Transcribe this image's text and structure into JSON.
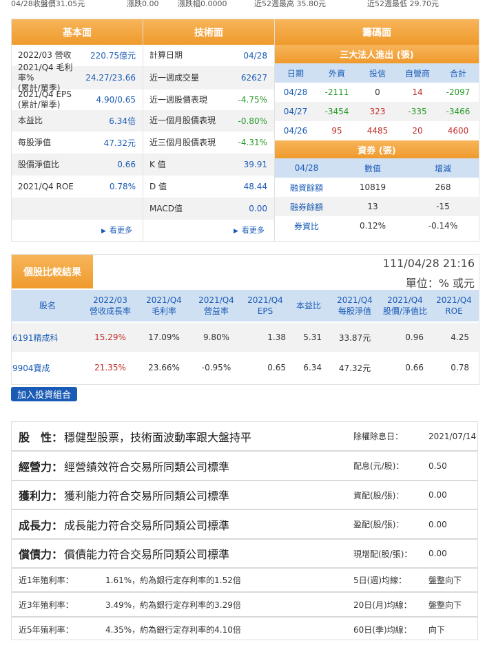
{
  "topline": {
    "close_price": "04/28收盤價31.05元",
    "change": "漲跌0.00",
    "change_pct": "漲跌幅0.0000",
    "high52": "近52週最高 35.80元",
    "low52": "近52週最低 29.70元"
  },
  "fundamental": {
    "header": "基本面",
    "rows": [
      {
        "label": "2022/03 營收",
        "value": "220.75億元"
      },
      {
        "label": "2021/Q4 毛利率%\n(累計/單季)",
        "value": "24.27/23.66"
      },
      {
        "label": "2021/Q4 EPS\n(累計/單季)",
        "value": "4.90/0.65"
      },
      {
        "label": "本益比",
        "value": "6.34倍"
      },
      {
        "label": "每股淨值",
        "value": "47.32元"
      },
      {
        "label": "股價淨值比",
        "value": "0.66"
      },
      {
        "label": "2021/Q4 ROE",
        "value": "0.78%"
      }
    ],
    "more": "看更多"
  },
  "technical": {
    "header": "技術面",
    "rows": [
      {
        "label": "計算日期",
        "value": "04/28"
      },
      {
        "label": "近一週成交量",
        "value": "62627"
      },
      {
        "label": "近一週股價表現",
        "value": "-4.75%"
      },
      {
        "label": "近一個月股價表現",
        "value": "-0.80%"
      },
      {
        "label": "近三個月股價表現",
        "value": "-4.31%"
      },
      {
        "label": "K 值",
        "value": "39.91"
      },
      {
        "label": "D 值",
        "value": "48.44"
      },
      {
        "label": "MACD值",
        "value": "0.00"
      }
    ],
    "more": "看更多"
  },
  "chips": {
    "header": "籌碼面",
    "institutional": {
      "title": "三大法人進出 (張)",
      "columns": [
        "日期",
        "外資",
        "投信",
        "自營商",
        "合計"
      ],
      "rows": [
        [
          "04/28",
          "-2111",
          "0",
          "14",
          "-2097"
        ],
        [
          "04/27",
          "-3454",
          "323",
          "-335",
          "-3466"
        ],
        [
          "04/26",
          "95",
          "4485",
          "20",
          "4600"
        ]
      ]
    },
    "margin": {
      "title": "資券 (張)",
      "columns": [
        "04/28",
        "數值",
        "增減"
      ],
      "rows": [
        [
          "融資餘額",
          "10819",
          "268"
        ],
        [
          "融券餘額",
          "13",
          "-15"
        ],
        [
          "券資比",
          "0.12%",
          "-0.14%"
        ]
      ]
    }
  },
  "comparison": {
    "title": "個股比較結果",
    "timestamp": "111/04/28 21:16",
    "unit": "單位：% 或元",
    "columns": [
      "股名",
      "2022/03\n營收成長率",
      "2021/Q4\n毛利率",
      "2021/Q4\n營益率",
      "2021/Q4\nEPS",
      "本益比",
      "2021/Q4\n每股淨值",
      "2021/Q4\n股價/淨值比",
      "2021/Q4\nROE"
    ],
    "rows": [
      [
        "6191精成科",
        "15.29%",
        "17.09%",
        "9.80%",
        "1.38",
        "5.31",
        "33.87元",
        "0.96",
        "4.25"
      ],
      [
        "9904寶成",
        "21.35%",
        "23.66%",
        "-0.95%",
        "0.65",
        "6.34",
        "47.32元",
        "0.66",
        "0.78"
      ]
    ],
    "add_button": "加入投資組合"
  },
  "profile": {
    "rows": [
      {
        "key": "股　性：",
        "text": "穩健型股票，技術面波動率跟大盤持平",
        "rlabel": "除權除息日：",
        "rvalue": "2021/07/14"
      },
      {
        "key": "經營力：",
        "text": "經營績效符合交易所同類公司標準",
        "rlabel": "配息(元/股)：",
        "rvalue": "0.50"
      },
      {
        "key": "獲利力：",
        "text": "獲利能力符合交易所同類公司標準",
        "rlabel": "資配(股/張)：",
        "rvalue": "0.00"
      },
      {
        "key": "成長力：",
        "text": "成長能力符合交易所同類公司標準",
        "rlabel": "盈配(股/張)：",
        "rvalue": "0.00"
      },
      {
        "key": "償債力：",
        "text": "償債能力符合交易所同類公司標準",
        "rlabel": "現增配(股/張)：",
        "rvalue": "0.00"
      }
    ],
    "yield_rows": [
      {
        "label": "近1年殖利率：",
        "text": "1.61%，約為銀行定存利率的1.52倍",
        "rlabel": "5日(週)均線：",
        "rvalue": "盤整向下"
      },
      {
        "label": "近3年殖利率：",
        "text": "3.49%，約為銀行定存利率的3.29倍",
        "rlabel": "20日(月)均線：",
        "rvalue": "盤整向下"
      },
      {
        "label": "近5年殖利率：",
        "text": "4.35%，約為銀行定存利率的4.10倍",
        "rlabel": "60日(季)均線：",
        "rvalue": "向下"
      }
    ]
  }
}
